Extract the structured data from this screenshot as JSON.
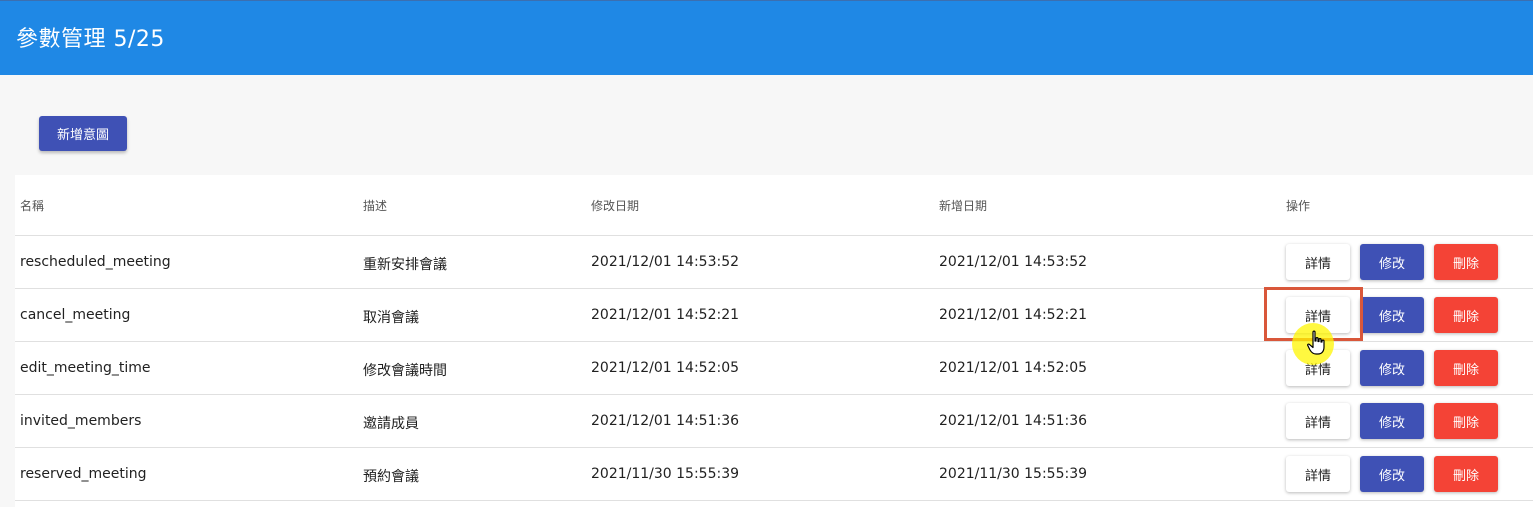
{
  "header": {
    "title": "參數管理 5/25"
  },
  "toolbar": {
    "add_intent_label": "新增意圖"
  },
  "table": {
    "headers": {
      "name": "名稱",
      "description": "描述",
      "modified": "修改日期",
      "created": "新增日期",
      "actions": "操作"
    },
    "rows": [
      {
        "name": "rescheduled_meeting",
        "description": "重新安排會議",
        "modified": "2021/12/01 14:53:52",
        "created": "2021/12/01 14:53:52"
      },
      {
        "name": "cancel_meeting",
        "description": "取消會議",
        "modified": "2021/12/01 14:52:21",
        "created": "2021/12/01 14:52:21"
      },
      {
        "name": "edit_meeting_time",
        "description": "修改會議時間",
        "modified": "2021/12/01 14:52:05",
        "created": "2021/12/01 14:52:05"
      },
      {
        "name": "invited_members",
        "description": "邀請成員",
        "modified": "2021/12/01 14:51:36",
        "created": "2021/12/01 14:51:36"
      },
      {
        "name": "reserved_meeting",
        "description": "預約會議",
        "modified": "2021/11/30 15:55:39",
        "created": "2021/11/30 15:55:39"
      }
    ],
    "actions": {
      "detail": "詳情",
      "edit": "修改",
      "delete": "刪除"
    }
  },
  "colors": {
    "header_bg": "#1f88e5",
    "primary": "#3f51b5",
    "danger": "#f44336",
    "highlight": "#d9573a"
  },
  "cursor": {
    "icon": "hand-pointer-icon"
  }
}
